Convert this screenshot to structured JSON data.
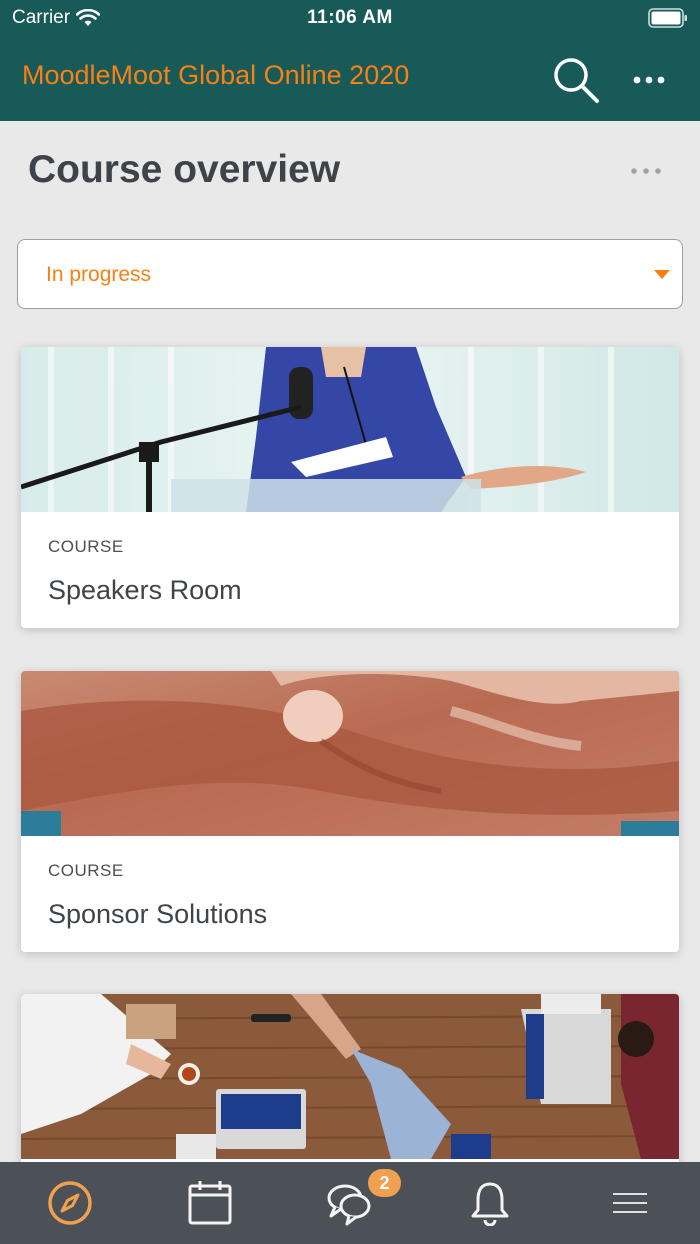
{
  "status_bar": {
    "carrier": "Carrier",
    "time": "11:06 AM"
  },
  "header": {
    "site_title": "MoodleMoot Global Online 2020",
    "search_icon": "search-icon",
    "menu_icon": "more-icon"
  },
  "page": {
    "title": "Course overview"
  },
  "filter": {
    "selected": "In progress"
  },
  "courses": [
    {
      "category": "COURSE",
      "name": "Speakers Room",
      "image": "speaker-at-podium"
    },
    {
      "category": "COURSE",
      "name": "Sponsor Solutions",
      "image": "handshake"
    },
    {
      "category": "",
      "name": "",
      "image": "meeting-table-laptops"
    }
  ],
  "tabbar": {
    "items": [
      "compass-icon",
      "calendar-icon",
      "messages-icon",
      "bell-icon",
      "menu-icon"
    ],
    "messages_badge": "2"
  },
  "colors": {
    "header_bg": "#185a58",
    "accent": "#f98012",
    "tabbar_bg": "#4b5156",
    "badge": "#f0a14f"
  }
}
